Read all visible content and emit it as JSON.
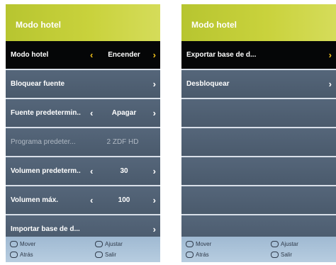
{
  "left_panel": {
    "title": "Modo hotel",
    "rows": [
      {
        "label": "Modo hotel",
        "value": "Encender",
        "arrow_left": "‹",
        "arrow_right": "›"
      },
      {
        "label": "Bloquear fuente",
        "arrow_right": "›"
      },
      {
        "label": "Fuente predetermin..",
        "value": "Apagar",
        "arrow_left": "‹",
        "arrow_right": "›"
      },
      {
        "label": "Programa predeter...",
        "value": "2 ZDF HD"
      },
      {
        "label": "Volumen predeterm..",
        "value": "30",
        "arrow_left": "‹",
        "arrow_right": "›"
      },
      {
        "label": "Volumen máx.",
        "value": "100",
        "arrow_left": "‹",
        "arrow_right": "›"
      },
      {
        "label": "Importar base de d...",
        "arrow_right": "›"
      }
    ],
    "footer": {
      "move": "Mover",
      "adjust": "Ajustar",
      "back": "Atrás",
      "exit": "Salir"
    }
  },
  "right_panel": {
    "title": "Modo hotel",
    "rows": [
      {
        "label": "Exportar base de d...",
        "arrow_right": "›"
      },
      {
        "label": "Desbloquear",
        "arrow_right": "›"
      }
    ],
    "footer": {
      "move": "Mover",
      "adjust": "Ajustar",
      "back": "Atrás",
      "exit": "Salir"
    }
  },
  "colors": {
    "header_green": "#c2cc36",
    "selected_arrow": "#f2c21a",
    "row_background": "#4f6073",
    "footer_background": "#aac2d8"
  }
}
